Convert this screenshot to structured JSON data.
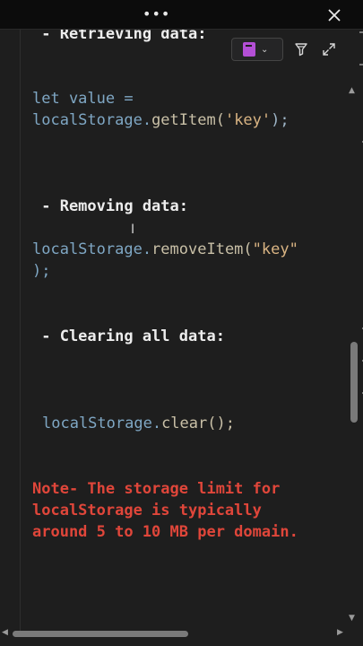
{
  "window": {
    "menu_label": "•••",
    "close_label": "✕"
  },
  "toolbar": {
    "notebook_icon": "notebook-icon",
    "chevron": "⌄",
    "funnel_icon": "funnel-icon",
    "expand_icon": "expand-icon"
  },
  "content": {
    "heading_retrieving": " - Retrieving data:",
    "code_get": {
      "line1": "let value =",
      "line2_obj": "localStorage.",
      "line2_fn": "getItem(",
      "line2_str": "'key'",
      "line2_end": ");"
    },
    "heading_removing": " - Removing data:",
    "code_remove": {
      "line1_obj": "localStorage.",
      "line1_fn": "removeItem(",
      "line1_str": "\"key\"",
      "line2": ");"
    },
    "heading_clearing": " - Clearing all data:",
    "code_clear": {
      "obj": "localStorage.",
      "fn": "clear();"
    },
    "note": {
      "line1": "Note- The storage limit for",
      "line2": "localStorage is typically",
      "line3": "around 5 to 10 MB per domain."
    },
    "cursor": "I"
  },
  "scrollbars": {
    "up": "▲",
    "down": "▼",
    "left": "◀",
    "right": "▶"
  },
  "colors": {
    "note_red": "#e0463a",
    "code_blue": "#7fa7c4",
    "string_tan": "#d9b483",
    "accent_purple": "#b44fd6"
  }
}
